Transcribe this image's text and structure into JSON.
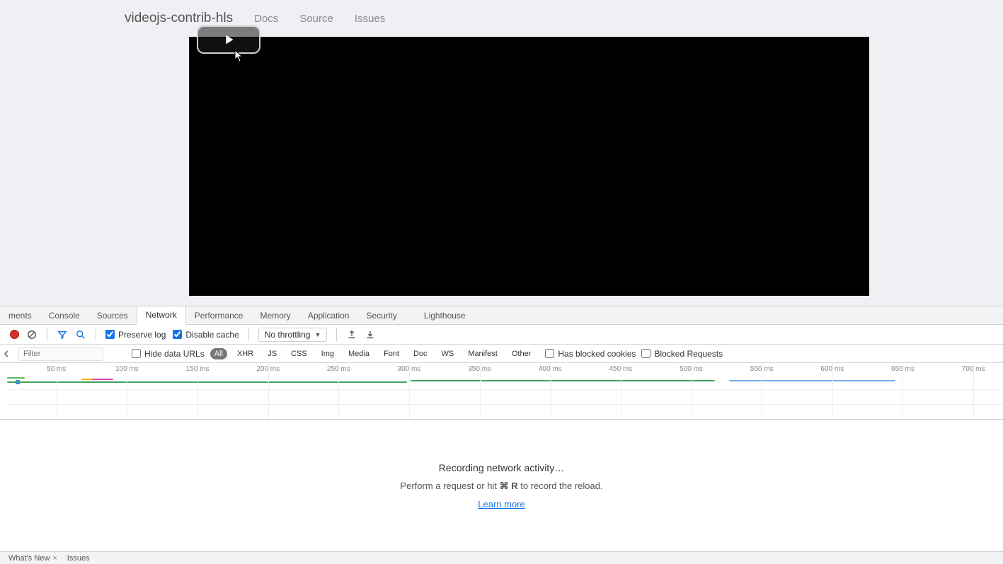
{
  "page": {
    "brand": "videojs-contrib-hls",
    "nav": [
      "Docs",
      "Source",
      "Issues"
    ]
  },
  "devtools": {
    "tabs": [
      "ments",
      "Console",
      "Sources",
      "Network",
      "Performance",
      "Memory",
      "Application",
      "Security",
      "Lighthouse"
    ],
    "active_tab": 3,
    "toolbar": {
      "preserve_log": "Preserve log",
      "disable_cache": "Disable cache",
      "throttling_label": "No throttling"
    },
    "filter": {
      "placeholder": "Filter",
      "hide_data_urls": "Hide data URLs",
      "types": [
        "All",
        "XHR",
        "JS",
        "CSS",
        "Img",
        "Media",
        "Font",
        "Doc",
        "WS",
        "Manifest",
        "Other"
      ],
      "active_type": 0,
      "has_blocked_cookies": "Has blocked cookies",
      "blocked_requests": "Blocked Requests"
    },
    "timeline": {
      "ticks": [
        "50 ms",
        "100 ms",
        "150 ms",
        "200 ms",
        "250 ms",
        "300 ms",
        "350 ms",
        "400 ms",
        "450 ms",
        "500 ms",
        "550 ms",
        "600 ms",
        "650 ms",
        "700 ms"
      ]
    },
    "empty": {
      "line1": "Recording network activity…",
      "line2_pre": "Perform a request or hit ",
      "line2_key": "⌘ R",
      "line2_post": " to record the reload.",
      "learn_more": "Learn more"
    },
    "drawer": {
      "tab1": "What's New",
      "tab2": "Issues"
    }
  }
}
